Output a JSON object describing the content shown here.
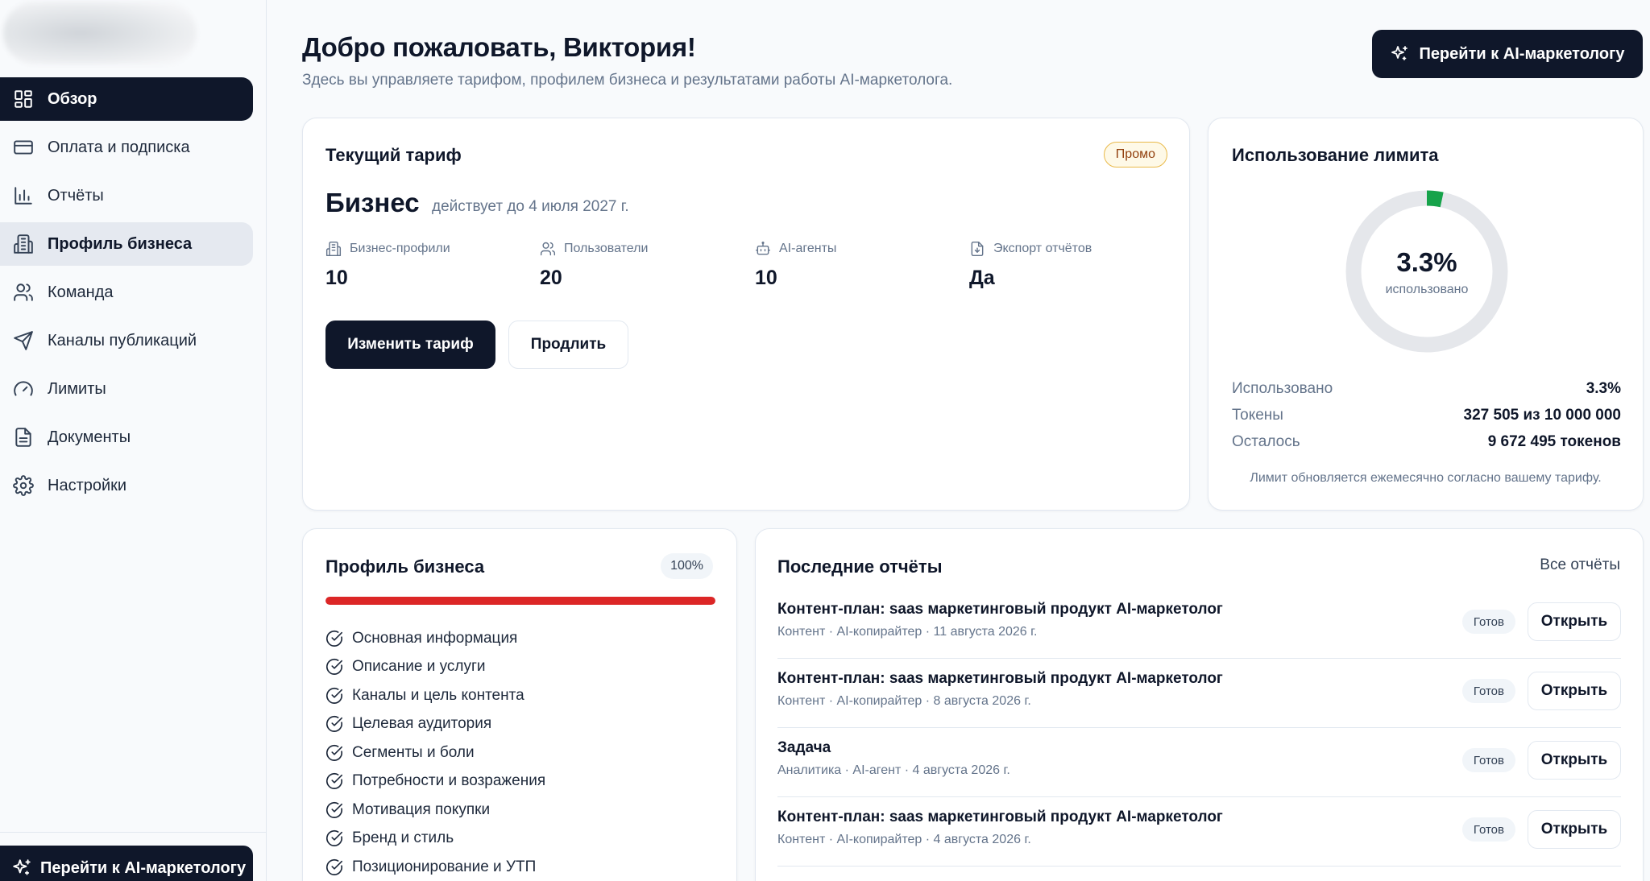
{
  "sidebar": {
    "items": [
      {
        "label": "Обзор",
        "icon": "grid-icon",
        "state": "active"
      },
      {
        "label": "Оплата и подписка",
        "icon": "credit-card-icon",
        "state": ""
      },
      {
        "label": "Отчёты",
        "icon": "bar-chart-icon",
        "state": ""
      },
      {
        "label": "Профиль бизнеса",
        "icon": "building-icon",
        "state": "hover"
      },
      {
        "label": "Команда",
        "icon": "users-icon",
        "state": ""
      },
      {
        "label": "Каналы публикаций",
        "icon": "send-icon",
        "state": ""
      },
      {
        "label": "Лимиты",
        "icon": "gauge-icon",
        "state": ""
      },
      {
        "label": "Документы",
        "icon": "document-icon",
        "state": ""
      },
      {
        "label": "Настройки",
        "icon": "gear-icon",
        "state": ""
      }
    ],
    "cta_label": "Перейти к AI-маркетологу"
  },
  "header": {
    "title": "Добро пожаловать, Виктория!",
    "subtitle": "Здесь вы управляете тарифом, профилем бизнеса и результатами работы AI-маркетолога.",
    "cta_label": "Перейти к AI-маркетологу"
  },
  "tariff": {
    "title": "Текущий тариф",
    "badge": "Промо",
    "plan": "Бизнес",
    "valid_until": "действует до 4 июля 2027 г.",
    "features": [
      {
        "label": "Бизнес-профили",
        "value": "10",
        "icon": "building-icon"
      },
      {
        "label": "Пользователи",
        "value": "20",
        "icon": "users-icon"
      },
      {
        "label": "AI-агенты",
        "value": "10",
        "icon": "bot-icon"
      },
      {
        "label": "Экспорт отчётов",
        "value": "Да",
        "icon": "file-export-icon"
      }
    ],
    "change_label": "Изменить тариф",
    "extend_label": "Продлить"
  },
  "limit": {
    "title": "Использование лимита",
    "percent_label": "3.3%",
    "percent_value": 3.3,
    "percent_caption": "использовано",
    "rows": [
      {
        "key": "Использовано",
        "value": "3.3%"
      },
      {
        "key": "Токены",
        "value": "327 505 из 10 000 000"
      },
      {
        "key": "Осталось",
        "value": "9 672 495 токенов"
      }
    ],
    "note": "Лимит обновляется ежемесячно согласно вашему тарифу.",
    "colors": {
      "used": "#16a34a",
      "track": "#e5e7eb"
    }
  },
  "profile": {
    "title": "Профиль бизнеса",
    "percent_label": "100%",
    "progress": 1.0,
    "bar_color": "#dc2626",
    "items": [
      "Основная информация",
      "Описание и услуги",
      "Каналы и цель контента",
      "Целевая аудитория",
      "Сегменты и боли",
      "Потребности и возражения",
      "Мотивация покупки",
      "Бренд и стиль",
      "Позиционирование и УТП"
    ]
  },
  "reports": {
    "title": "Последние отчёты",
    "all_label": "Все отчёты",
    "open_label": "Открыть",
    "rows": [
      {
        "title": "Контент-план: saas маркетинговый продукт AI-маркетолог",
        "meta": "Контент · AI-копирайтер · 11 августа 2026 г.",
        "status": "Готов"
      },
      {
        "title": "Контент-план: saas маркетинговый продукт AI-маркетолог",
        "meta": "Контент · AI-копирайтер · 8 августа 2026 г.",
        "status": "Готов"
      },
      {
        "title": "Задача",
        "meta": "Аналитика · AI-агент · 4 августа 2026 г.",
        "status": "Готов"
      },
      {
        "title": "Контент-план: saas маркетинговый продукт AI-маркетолог",
        "meta": "Контент · AI-копирайтер · 4 августа 2026 г.",
        "status": "Готов"
      }
    ]
  }
}
